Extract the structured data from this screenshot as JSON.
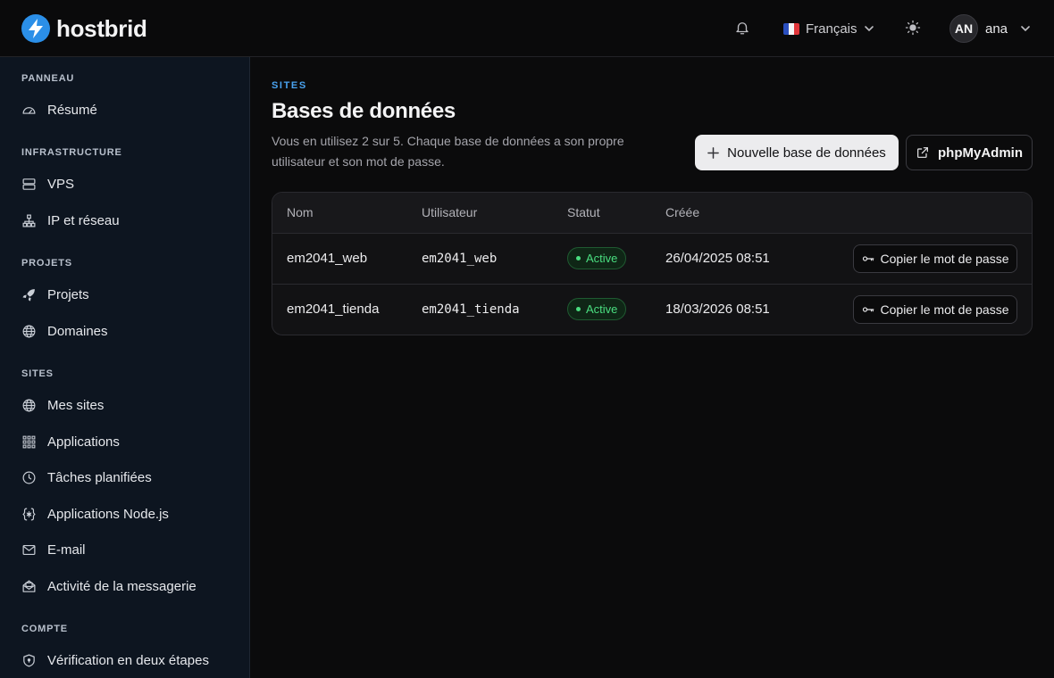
{
  "brand": {
    "name": "hostbrid",
    "accent": "#2b8fe8"
  },
  "topbar": {
    "language": "Français",
    "user_initials": "AN",
    "user_name": "ana"
  },
  "sidebar": {
    "sections": [
      {
        "title": "PANNEAU",
        "items": [
          {
            "label": "Résumé",
            "icon": "gauge-icon"
          }
        ]
      },
      {
        "title": "INFRASTRUCTURE",
        "items": [
          {
            "label": "VPS",
            "icon": "server-icon"
          },
          {
            "label": "IP et réseau",
            "icon": "network-icon"
          }
        ]
      },
      {
        "title": "PROJETS",
        "items": [
          {
            "label": "Projets",
            "icon": "rocket-icon"
          },
          {
            "label": "Domaines",
            "icon": "globe-icon"
          }
        ]
      },
      {
        "title": "SITES",
        "items": [
          {
            "label": "Mes sites",
            "icon": "globe-icon"
          },
          {
            "label": "Applications",
            "icon": "grid-icon"
          },
          {
            "label": "Tâches planifiées",
            "icon": "clock-icon"
          },
          {
            "label": "Applications Node.js",
            "icon": "braces-icon"
          },
          {
            "label": "E-mail",
            "icon": "mail-icon"
          },
          {
            "label": "Activité de la messagerie",
            "icon": "mail-open-icon"
          }
        ]
      },
      {
        "title": "COMPTE",
        "items": [
          {
            "label": "Vérification en deux étapes",
            "icon": "shield-icon"
          }
        ]
      }
    ]
  },
  "main": {
    "eyebrow": "SITES",
    "title": "Bases de données",
    "description": "Vous en utilisez 2 sur 5. Chaque base de données a son propre utilisateur et son mot de passe.",
    "new_button": "Nouvelle base de données",
    "pma_button": "phpMyAdmin",
    "table": {
      "headers": [
        "Nom",
        "Utilisateur",
        "Statut",
        "Créée"
      ],
      "rows": [
        {
          "name": "em2041_web",
          "user": "em2041_web",
          "status": "Active",
          "created": "26/04/2025 08:51",
          "action": "Copier le mot de passe"
        },
        {
          "name": "em2041_tienda",
          "user": "em2041_tienda",
          "status": "Active",
          "created": "18/03/2026 08:51",
          "action": "Copier le mot de passe"
        }
      ]
    }
  }
}
